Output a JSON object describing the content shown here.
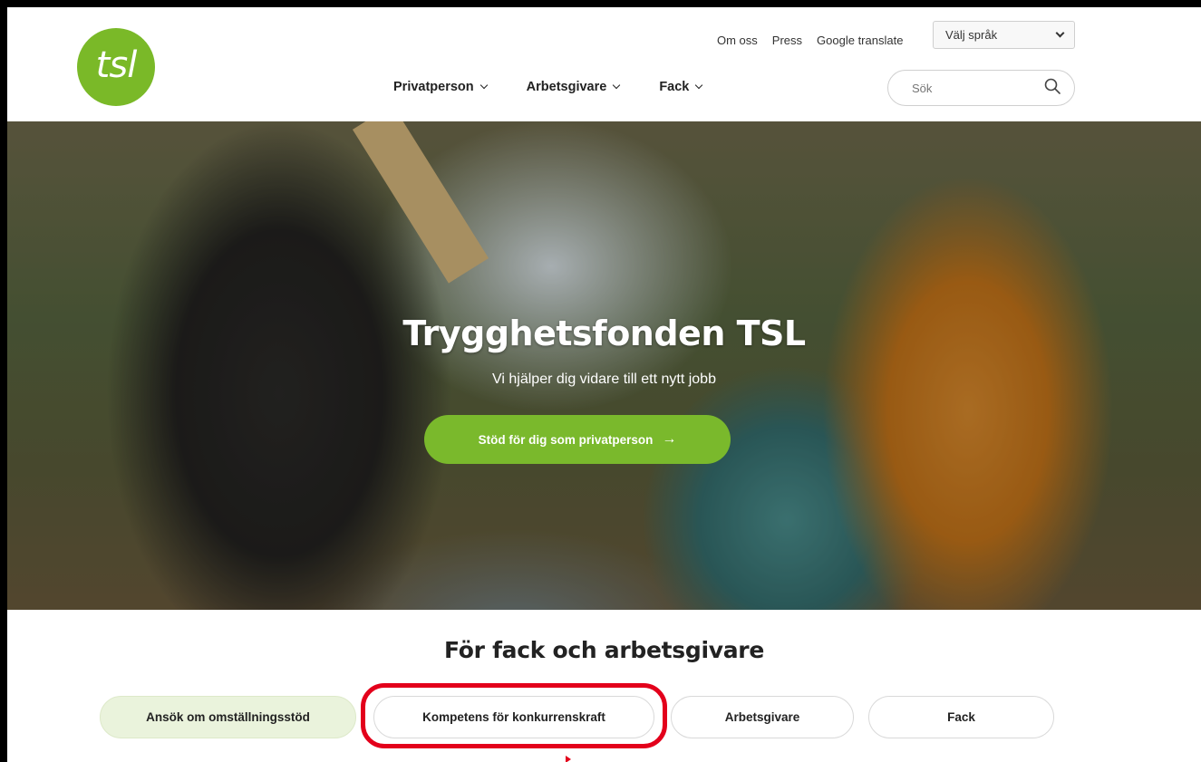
{
  "header": {
    "logo_text": "tsl",
    "top_links": [
      "Om oss",
      "Press",
      "Google translate"
    ],
    "language_select": "Välj språk",
    "nav": [
      {
        "label": "Privatperson"
      },
      {
        "label": "Arbetsgivare"
      },
      {
        "label": "Fack"
      }
    ],
    "search_placeholder": "Sök"
  },
  "hero": {
    "title": "Trygghetsfonden TSL",
    "subtitle": "Vi hjälper dig vidare till ett nytt jobb",
    "cta_label": "Stöd för dig som privatperson",
    "cta_arrow": "→"
  },
  "section": {
    "title": "För fack och arbetsgivare",
    "tabs": [
      {
        "label": "Ansök om omställningsstöd",
        "active": true
      },
      {
        "label": "Kompetens för konkurrenskraft",
        "highlighted": true
      },
      {
        "label": "Arbetsgivare"
      },
      {
        "label": "Fack"
      }
    ]
  },
  "colors": {
    "brand_green": "#7ab928",
    "highlight_red": "#e3001b",
    "active_tab_bg": "#eaf3dc"
  }
}
